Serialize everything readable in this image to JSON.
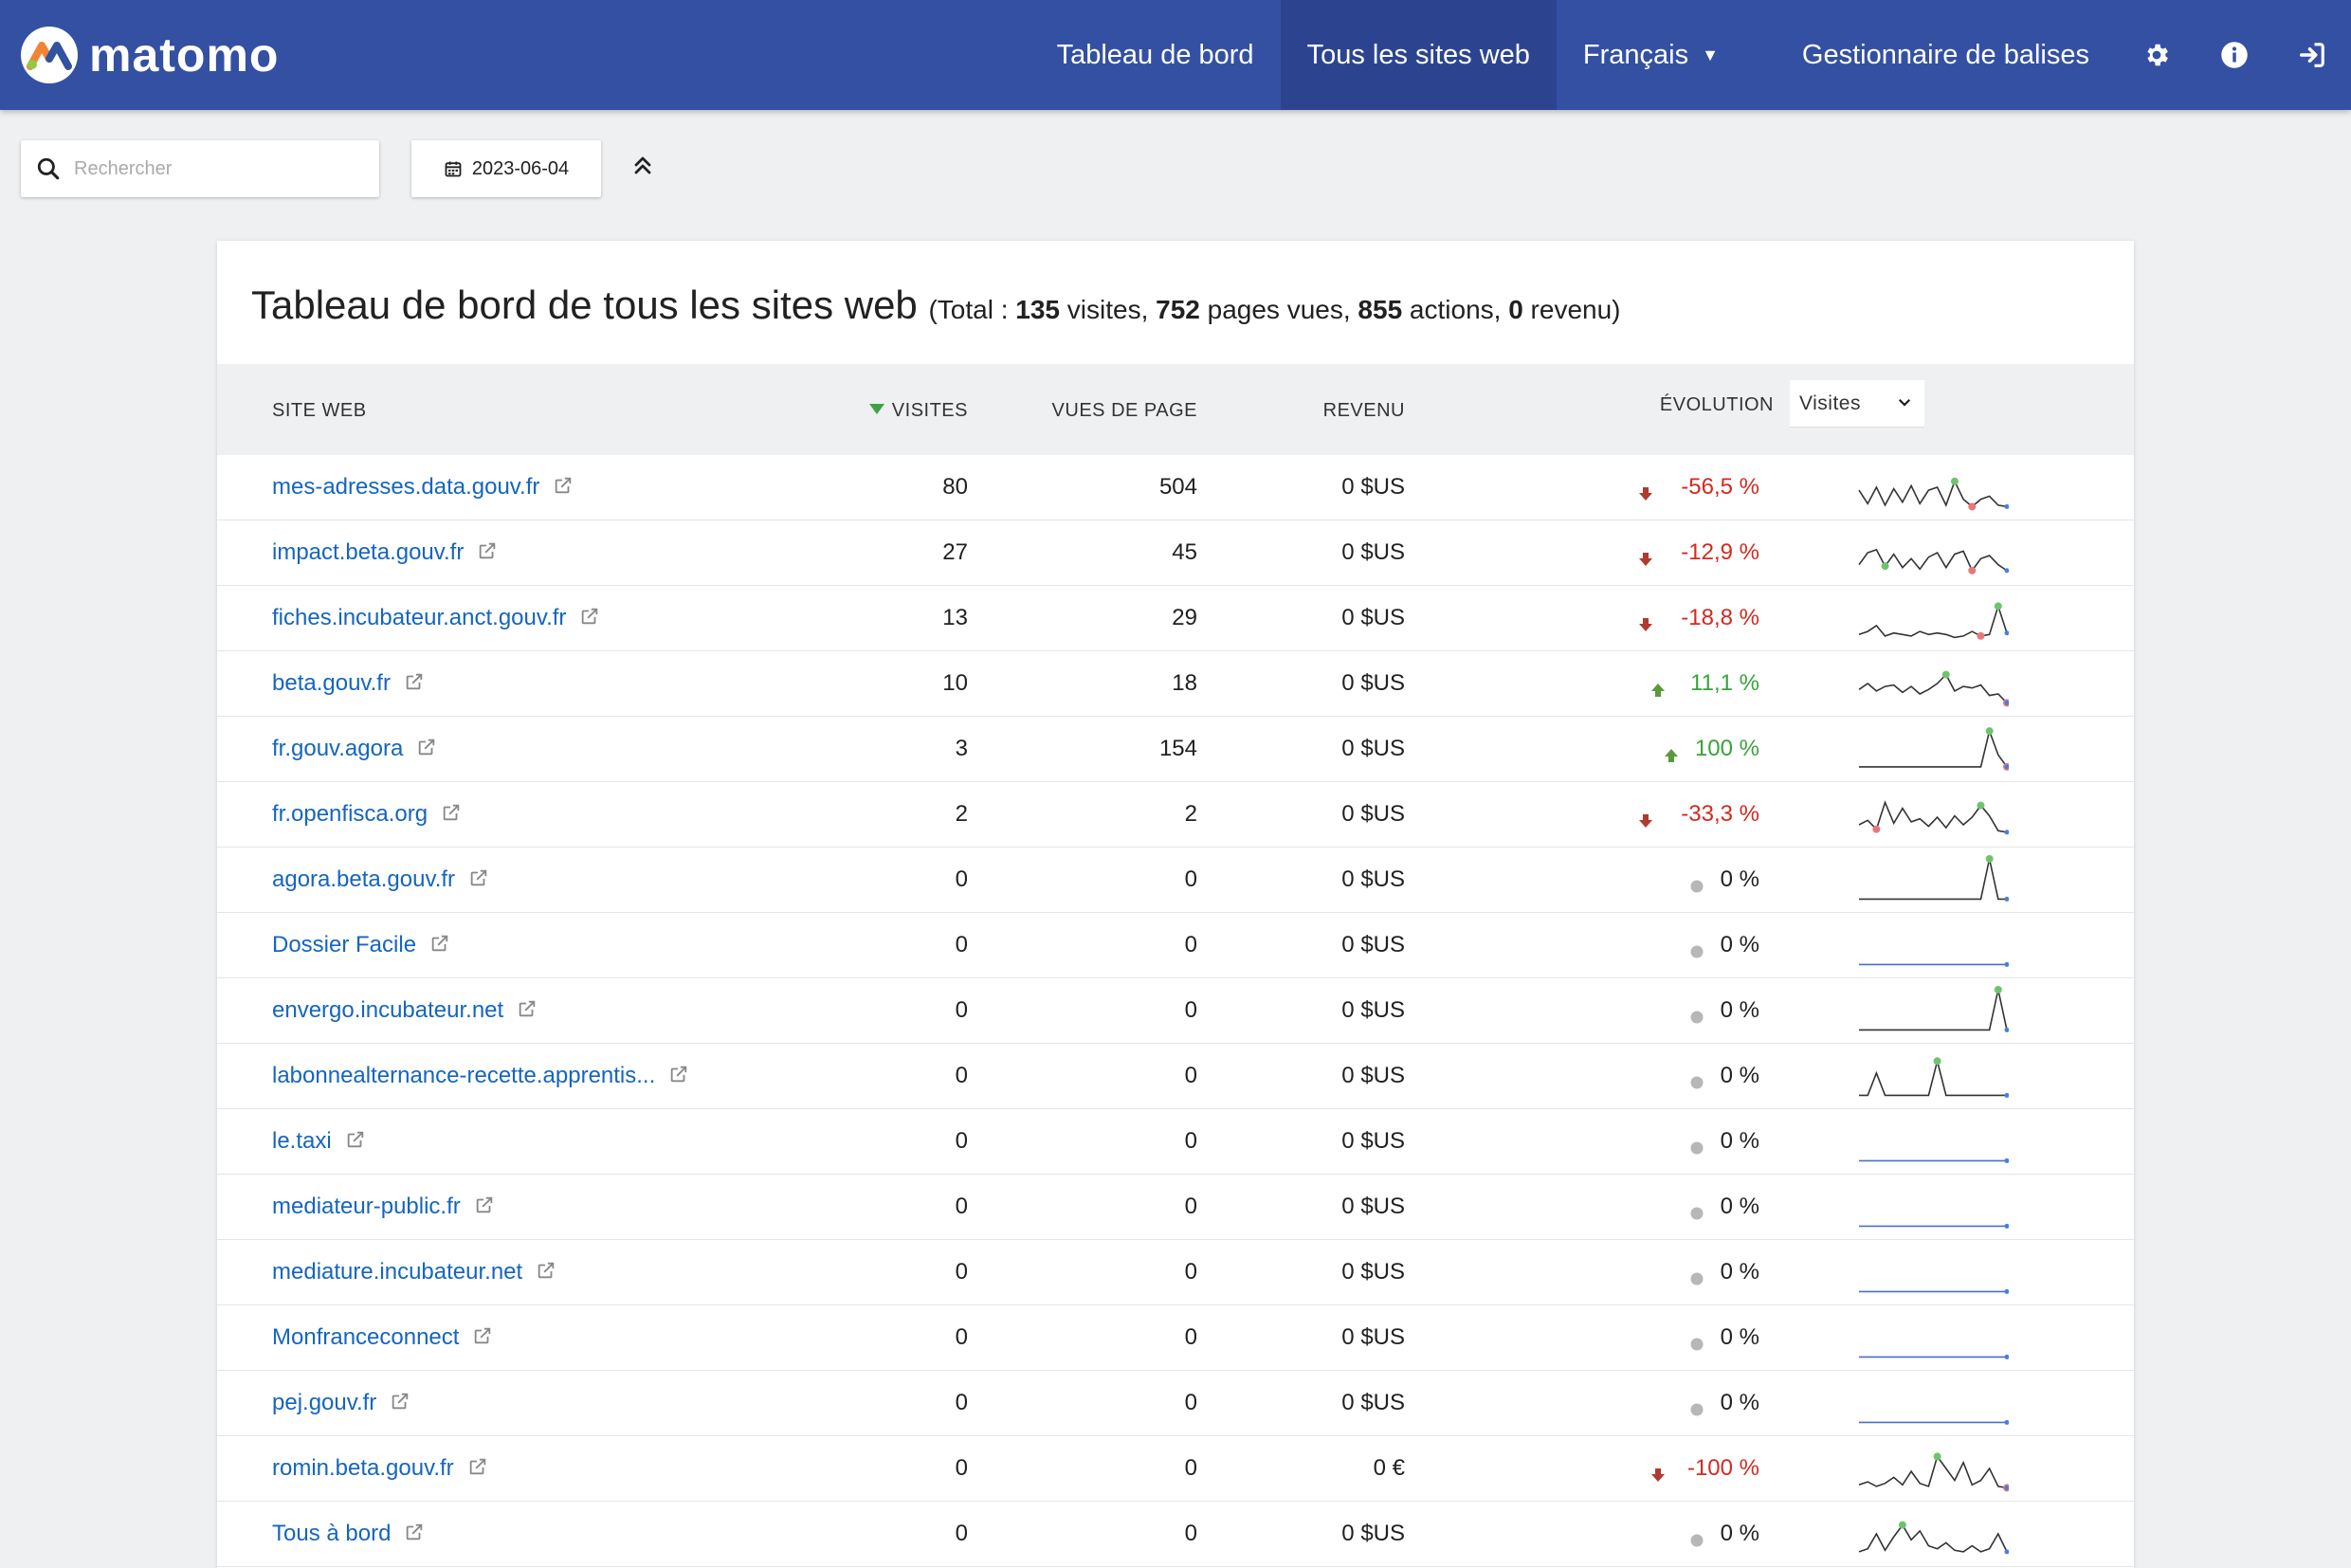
{
  "app": {
    "logo_text": "matomo",
    "nav": {
      "dashboard": "Tableau de bord",
      "all_websites": "Tous les sites web",
      "language": "Français",
      "tag_manager": "Gestionnaire de balises"
    },
    "nav_icons": [
      "gear-icon",
      "info-icon",
      "sign-in-icon"
    ]
  },
  "toolbar": {
    "search_placeholder": "Rechercher",
    "date": "2023-06-04"
  },
  "dashboard": {
    "title": "Tableau de bord de tous les sites web",
    "totals": {
      "prefix": "(Total : ",
      "visits": "135",
      "visits_label": " visites, ",
      "pageviews": "752",
      "pageviews_label": " pages vues, ",
      "actions": "855",
      "actions_label": " actions, ",
      "revenue": "0",
      "revenue_label": "  revenu)"
    },
    "columns": {
      "site": "SITE WEB",
      "visits": "VISITES",
      "pageviews": "VUES DE PAGE",
      "revenue": "REVENU",
      "evolution": "ÉVOLUTION",
      "metric_selected": "Visites"
    },
    "rows": [
      {
        "site": "mes-adresses.data.gouv.fr",
        "visits": "80",
        "pageviews": "504",
        "revenue": "0 $US",
        "evolution": "-56,5 %",
        "trend": "down",
        "spark": [
          12,
          3,
          14,
          2,
          13,
          4,
          15,
          3,
          12,
          14,
          2,
          18,
          6,
          1,
          6,
          8,
          2,
          1
        ],
        "hi": 11,
        "lo": 13
      },
      {
        "site": "impact.beta.gouv.fr",
        "visits": "27",
        "pageviews": "45",
        "revenue": "0 $US",
        "evolution": "-12,9 %",
        "trend": "down",
        "spark": [
          6,
          14,
          16,
          5,
          13,
          4,
          10,
          3,
          11,
          14,
          4,
          13,
          15,
          2,
          10,
          12,
          6,
          2
        ],
        "hi": 3,
        "lo": 13
      },
      {
        "site": "fiches.incubateur.anct.gouv.fr",
        "visits": "13",
        "pageviews": "29",
        "revenue": "0 $US",
        "evolution": "-18,8 %",
        "trend": "down",
        "spark": [
          3,
          5,
          9,
          2,
          4,
          3,
          2,
          5,
          3,
          4,
          3,
          1,
          2,
          5,
          2,
          3,
          22,
          4
        ],
        "hi": 16,
        "lo": 14
      },
      {
        "site": "beta.gouv.fr",
        "visits": "10",
        "pageviews": "18",
        "revenue": "0 $US",
        "evolution": "11,1 %",
        "trend": "up",
        "spark": [
          10,
          14,
          9,
          12,
          13,
          8,
          12,
          7,
          10,
          14,
          20,
          9,
          12,
          11,
          13,
          6,
          7,
          1
        ],
        "hi": 10,
        "lo": 17
      },
      {
        "site": "fr.gouv.agora",
        "visits": "3",
        "pageviews": "154",
        "revenue": "0 $US",
        "evolution": "100 %",
        "trend": "up",
        "spark": [
          2,
          2,
          2,
          2,
          2,
          2,
          2,
          2,
          2,
          2,
          2,
          2,
          2,
          2,
          2,
          26,
          10,
          2
        ],
        "hi": 15,
        "lo": 17
      },
      {
        "site": "fr.openfisca.org",
        "visits": "2",
        "pageviews": "2",
        "revenue": "0 $US",
        "evolution": "-33,3 %",
        "trend": "down",
        "spark": [
          7,
          10,
          4,
          22,
          8,
          18,
          9,
          11,
          6,
          12,
          5,
          13,
          7,
          12,
          20,
          13,
          3,
          2
        ],
        "hi": 14,
        "lo": 2
      },
      {
        "site": "agora.beta.gouv.fr",
        "visits": "0",
        "pageviews": "0",
        "revenue": "0 $US",
        "evolution": "0 %",
        "trend": "neutral",
        "spark": [
          1,
          1,
          1,
          1,
          1,
          1,
          1,
          1,
          1,
          1,
          1,
          1,
          1,
          1,
          1,
          28,
          1,
          1
        ],
        "hi": 15,
        "lo": -1
      },
      {
        "site": "Dossier Facile",
        "visits": "0",
        "pageviews": "0",
        "revenue": "0 $US",
        "evolution": "0 %",
        "trend": "neutral",
        "spark": [
          1,
          1,
          1,
          1,
          1,
          1,
          1,
          1,
          1,
          1,
          1,
          1,
          1,
          1,
          1,
          1,
          1,
          1
        ],
        "hi": -1,
        "lo": -1
      },
      {
        "site": "envergo.incubateur.net",
        "visits": "0",
        "pageviews": "0",
        "revenue": "0 $US",
        "evolution": "0 %",
        "trend": "neutral",
        "spark": [
          1,
          1,
          1,
          1,
          1,
          1,
          1,
          1,
          1,
          1,
          1,
          1,
          1,
          1,
          1,
          1,
          28,
          1
        ],
        "hi": 16,
        "lo": -1
      },
      {
        "site": "labonnealternance-recette.apprentis...",
        "visits": "0",
        "pageviews": "0",
        "revenue": "0 $US",
        "evolution": "0 %",
        "trend": "neutral",
        "spark": [
          1,
          1,
          16,
          1,
          1,
          1,
          1,
          1,
          1,
          24,
          1,
          1,
          1,
          1,
          1,
          1,
          1,
          1
        ],
        "hi": 9,
        "lo": -1
      },
      {
        "site": "le.taxi",
        "visits": "0",
        "pageviews": "0",
        "revenue": "0 $US",
        "evolution": "0 %",
        "trend": "neutral",
        "spark": [
          1,
          1,
          1,
          1,
          1,
          1,
          1,
          1,
          1,
          1,
          1,
          1,
          1,
          1,
          1,
          1,
          1,
          1
        ],
        "hi": -1,
        "lo": -1
      },
      {
        "site": "mediateur-public.fr",
        "visits": "0",
        "pageviews": "0",
        "revenue": "0 $US",
        "evolution": "0 %",
        "trend": "neutral",
        "spark": [
          1,
          1,
          1,
          1,
          1,
          1,
          1,
          1,
          1,
          1,
          1,
          1,
          1,
          1,
          1,
          1,
          1,
          1
        ],
        "hi": -1,
        "lo": -1
      },
      {
        "site": "mediature.incubateur.net",
        "visits": "0",
        "pageviews": "0",
        "revenue": "0 $US",
        "evolution": "0 %",
        "trend": "neutral",
        "spark": [
          1,
          1,
          1,
          1,
          1,
          1,
          1,
          1,
          1,
          1,
          1,
          1,
          1,
          1,
          1,
          1,
          1,
          1
        ],
        "hi": -1,
        "lo": -1
      },
      {
        "site": "Monfranceconnect",
        "visits": "0",
        "pageviews": "0",
        "revenue": "0 $US",
        "evolution": "0 %",
        "trend": "neutral",
        "spark": [
          1,
          1,
          1,
          1,
          1,
          1,
          1,
          1,
          1,
          1,
          1,
          1,
          1,
          1,
          1,
          1,
          1,
          1
        ],
        "hi": -1,
        "lo": -1
      },
      {
        "site": "pej.gouv.fr",
        "visits": "0",
        "pageviews": "0",
        "revenue": "0 $US",
        "evolution": "0 %",
        "trend": "neutral",
        "spark": [
          1,
          1,
          1,
          1,
          1,
          1,
          1,
          1,
          1,
          1,
          1,
          1,
          1,
          1,
          1,
          1,
          1,
          1
        ],
        "hi": -1,
        "lo": -1
      },
      {
        "site": "romin.beta.gouv.fr",
        "visits": "0",
        "pageviews": "0",
        "revenue": "0 €",
        "evolution": "-100 %",
        "trend": "down",
        "spark": [
          3,
          5,
          2,
          4,
          8,
          3,
          12,
          4,
          2,
          22,
          14,
          6,
          18,
          3,
          6,
          14,
          2,
          1
        ],
        "hi": 9,
        "lo": 17
      },
      {
        "site": "Tous à bord",
        "visits": "0",
        "pageviews": "0",
        "revenue": "0 $US",
        "evolution": "0 %",
        "trend": "neutral",
        "spark": [
          2,
          4,
          14,
          3,
          12,
          20,
          10,
          16,
          6,
          4,
          8,
          3,
          2,
          6,
          2,
          4,
          14,
          2
        ],
        "hi": 5,
        "lo": -1
      }
    ]
  },
  "colors": {
    "header_bg": "#3450a3",
    "active_nav": "#2c4490",
    "link": "#1565c0",
    "negative": "#d4291f",
    "positive": "#37a339",
    "spark_line": "#333333",
    "spark_high": "#6ec46e",
    "spark_low": "#e87878",
    "spark_last": "#4a7de0"
  }
}
